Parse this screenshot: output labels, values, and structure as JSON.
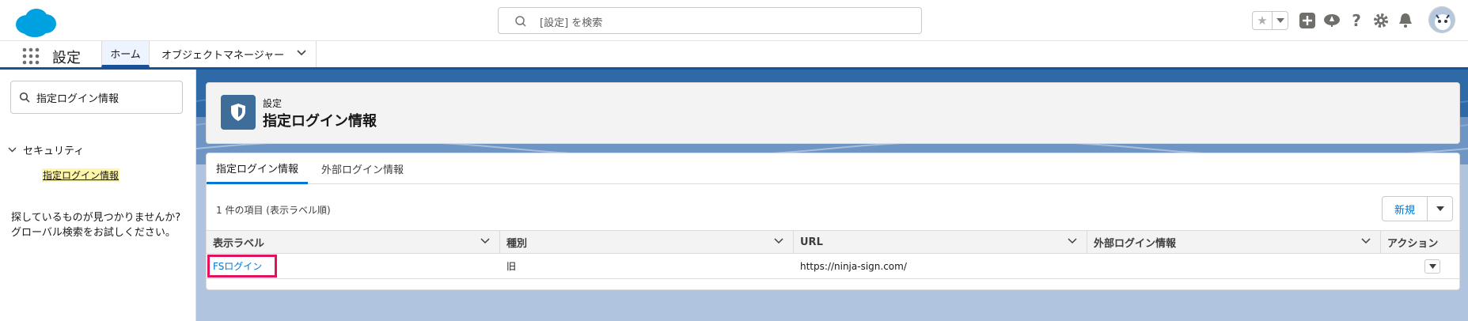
{
  "header": {
    "search_placeholder": "[設定] を検索",
    "icons": [
      "cloud-logo",
      "search-icon",
      "star-icon",
      "chevron-down-icon",
      "plus-icon",
      "trailhead-icon",
      "help-icon",
      "gear-icon",
      "bell-icon",
      "avatar"
    ]
  },
  "nav": {
    "app_name": "設定",
    "tabs": [
      {
        "label": "ホーム",
        "active": true
      },
      {
        "label": "オブジェクトマネージャー",
        "active": false
      }
    ]
  },
  "sidebar": {
    "quick_find_value": "指定ログイン情報",
    "section_label": "セキュリティ",
    "item_label": "指定ログイン情報",
    "not_found_line1": "探しているものが見つかりませんか?",
    "not_found_line2": "グローバル検索をお試しください。"
  },
  "page": {
    "breadcrumb": "設定",
    "title": "指定ログイン情報",
    "tabs": [
      {
        "label": "指定ログイン情報",
        "active": true
      },
      {
        "label": "外部ログイン情報",
        "active": false
      }
    ],
    "item_count": "1 件の項目 (表示ラベル順)",
    "new_button": "新規"
  },
  "table": {
    "columns": [
      "表示ラベル",
      "種別",
      "URL",
      "外部ログイン情報",
      "アクション"
    ],
    "rows": [
      {
        "label": "FSログイン",
        "type": "旧",
        "url": "https://ninja-sign.com/",
        "external": ""
      }
    ]
  },
  "colors": {
    "brand_blue": "#0176d3",
    "nav_accent": "#1b5297",
    "highlight_border": "#e0115f",
    "page_bg": "#b0c4df"
  }
}
